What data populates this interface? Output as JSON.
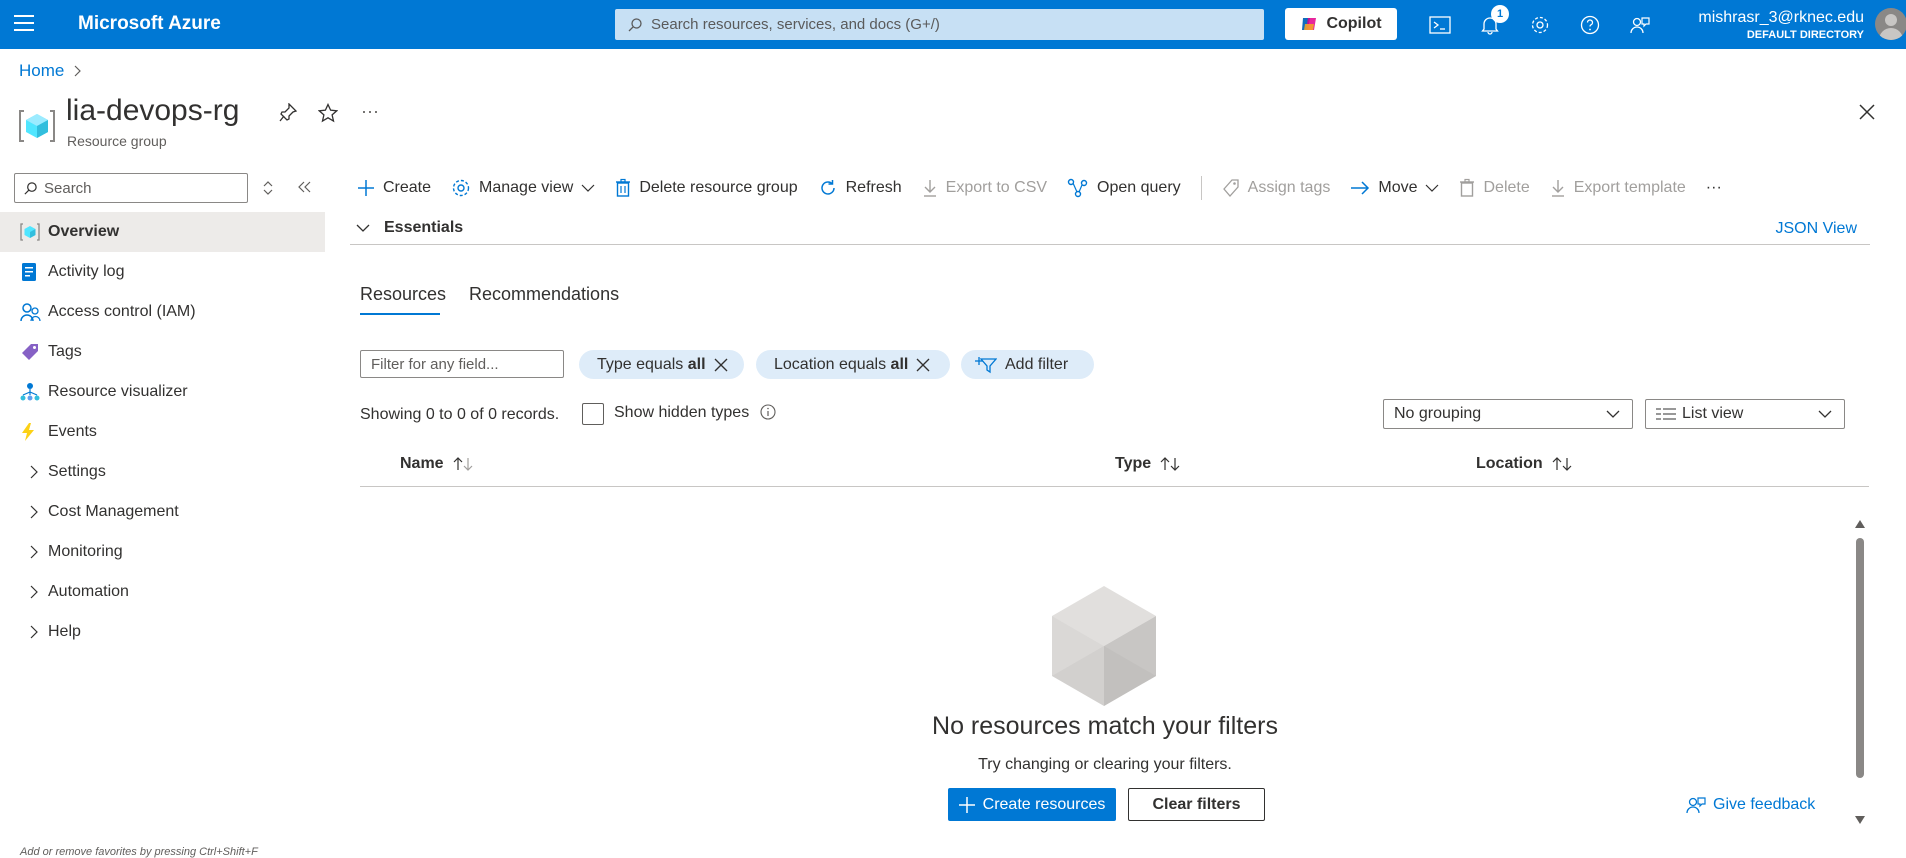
{
  "topbar": {
    "brand": "Microsoft Azure",
    "search_placeholder": "Search resources, services, and docs (G+/)",
    "copilot_label": "Copilot",
    "notification_count": "1",
    "account_name": "mishrasr_3@rknec.edu",
    "account_directory": "DEFAULT DIRECTORY",
    "accent": "#0078d4"
  },
  "breadcrumb": {
    "home": "Home"
  },
  "header": {
    "title": "lia-devops-rg",
    "subtitle": "Resource group",
    "more": "···"
  },
  "nav": {
    "search_placeholder": "Search",
    "items": [
      {
        "label": "Overview",
        "icon": "resource-group-icon"
      },
      {
        "label": "Activity log",
        "icon": "activity-log-icon"
      },
      {
        "label": "Access control (IAM)",
        "icon": "iam-icon"
      },
      {
        "label": "Tags",
        "icon": "tag-icon"
      },
      {
        "label": "Resource visualizer",
        "icon": "visualizer-icon"
      },
      {
        "label": "Events",
        "icon": "lightning-icon"
      },
      {
        "label": "Settings",
        "icon": "chevron-right-icon"
      },
      {
        "label": "Cost Management",
        "icon": "chevron-right-icon"
      },
      {
        "label": "Monitoring",
        "icon": "chevron-right-icon"
      },
      {
        "label": "Automation",
        "icon": "chevron-right-icon"
      },
      {
        "label": "Help",
        "icon": "chevron-right-icon"
      }
    ],
    "hint": "Add or remove favorites by pressing Ctrl+Shift+F"
  },
  "toolbar": {
    "create": "Create",
    "manage_view": "Manage view",
    "delete_rg": "Delete resource group",
    "refresh": "Refresh",
    "export_csv": "Export to CSV",
    "open_query": "Open query",
    "assign_tags": "Assign tags",
    "move": "Move",
    "delete": "Delete",
    "export_template": "Export template",
    "more": "···"
  },
  "essentials": {
    "label": "Essentials",
    "json_view": "JSON View"
  },
  "tabs": {
    "resources": "Resources",
    "recommendations": "Recommendations"
  },
  "filters": {
    "placeholder": "Filter for any field...",
    "type_prefix": "Type equals",
    "type_value": "all",
    "location_prefix": "Location equals",
    "location_value": "all",
    "add_filter": "Add filter"
  },
  "records": {
    "showing": "Showing 0 to 0 of 0 records.",
    "show_hidden": "Show hidden types",
    "grouping": "No grouping",
    "view": "List view"
  },
  "table": {
    "columns": [
      "Name",
      "Type",
      "Location"
    ]
  },
  "empty": {
    "title": "No resources match your filters",
    "subtitle": "Try changing or clearing your filters.",
    "create_button": "Create resources",
    "clear_button": "Clear filters"
  },
  "feedback": "Give feedback"
}
